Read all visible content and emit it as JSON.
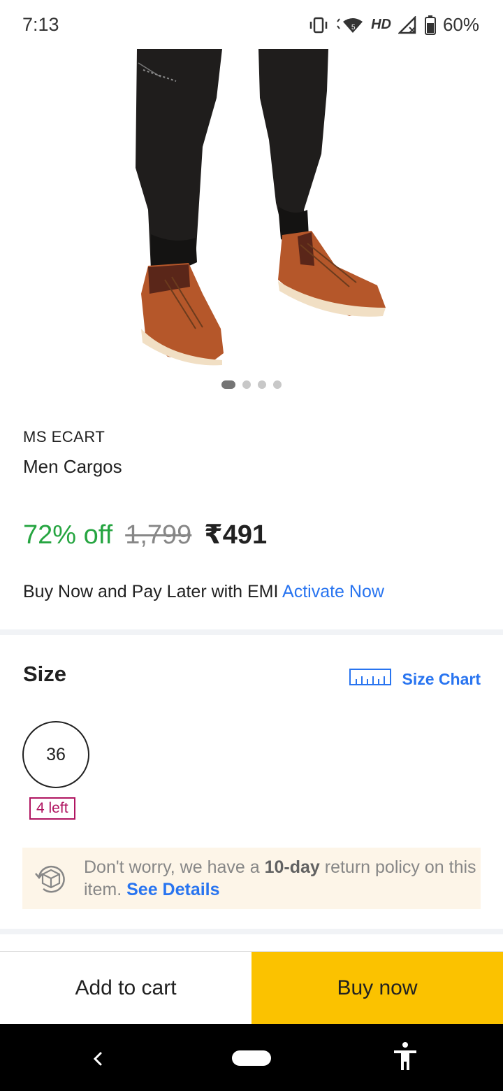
{
  "status_bar": {
    "time": "7:13",
    "network": "HD",
    "battery": "60%"
  },
  "carousel": {
    "total": 4,
    "active": 1
  },
  "product": {
    "brand": "MS ECART",
    "title": "Men Cargos",
    "discount": "72% off",
    "mrp": "1,799",
    "price": "₹491"
  },
  "emi": {
    "text": "Buy Now and Pay Later with EMI",
    "link": "Activate Now"
  },
  "size": {
    "heading": "Size",
    "chart_label": "Size Chart",
    "options": [
      {
        "label": "36",
        "stock": "4 left"
      }
    ]
  },
  "return_policy": {
    "text_before": "Don't worry, we have a ",
    "highlight": "10-day",
    "text_after": " return policy on this item. ",
    "link": "See Details"
  },
  "actions": {
    "add_to_cart": "Add to cart",
    "buy_now": "Buy now"
  },
  "colors": {
    "discount_green": "#26a541",
    "link_blue": "#2874f0",
    "buy_yellow": "#fbc200",
    "stock_magenta": "#b01561",
    "return_bg": "#fdf5e8"
  }
}
